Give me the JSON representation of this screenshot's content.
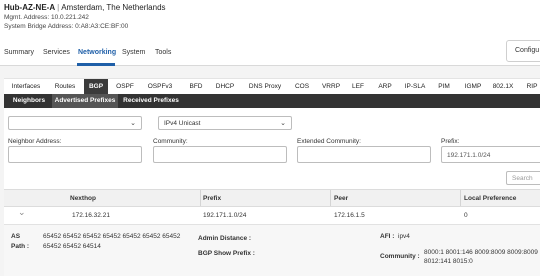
{
  "device": {
    "name": "Hub-AZ-NE-A",
    "location": "Amsterdam, The Netherlands",
    "mgmt_address": "Mgmt. Address: 10.0.221.242",
    "bridge_address": "System Bridge Address: 0:A8:A3:CE:BF:00"
  },
  "main_tabs": [
    {
      "label": "Summary"
    },
    {
      "label": "Services"
    },
    {
      "label": "Networking"
    },
    {
      "label": "System"
    },
    {
      "label": "Tools"
    }
  ],
  "configure_label": "Configu",
  "protocol_tabs": [
    "Interfaces",
    "Routes",
    "BGP",
    "OSPF",
    "OSPFv3",
    "BFD",
    "DHCP",
    "DNS Proxy",
    "COS",
    "VRRP",
    "LEF",
    "ARP",
    "IP-SLA",
    "PIM",
    "IGMP",
    "802.1X",
    "RIP"
  ],
  "sub_tabs": [
    "Neighbors",
    "Advertised Prefixes",
    "Received Prefixes"
  ],
  "filters": {
    "select1_value": "",
    "select2_value": "IPv4 Unicast",
    "neighbor_label": "Neighbor Address:",
    "neighbor_value": "",
    "community_label": "Community:",
    "community_value": "",
    "ext_community_label": "Extended Community:",
    "ext_community_value": "",
    "prefix_label": "Prefix:",
    "prefix_value": "192.171.1.0/24",
    "search_placeholder": "Search"
  },
  "table": {
    "headers": [
      "Nexthop",
      "Prefix",
      "Peer",
      "Local Preference"
    ],
    "rows": [
      {
        "nexthop": "172.16.32.21",
        "prefix": "192.171.1.0/24",
        "peer": "172.16.1.5",
        "local_pref": "0"
      }
    ]
  },
  "detail": {
    "as_path_label": "AS\nPath :",
    "as_path_line1": "65452 65452 65452 65452 65452 65452 65452",
    "as_path_line2": "65452 65452 64514",
    "admin_distance_label": "Admin Distance :",
    "admin_distance_value": "",
    "bgp_show_prefix_label": "BGP Show Prefix :",
    "bgp_show_prefix_value": "",
    "afi_label": "AFI :",
    "afi_value": "ipv4",
    "community_label": "Community :",
    "community_line1": "8000:1 8001:146 8009:8009 8009:8009",
    "community_line2": "8012:141 8015:0"
  },
  "icons": {
    "chevron": "chevron-down-icon"
  }
}
